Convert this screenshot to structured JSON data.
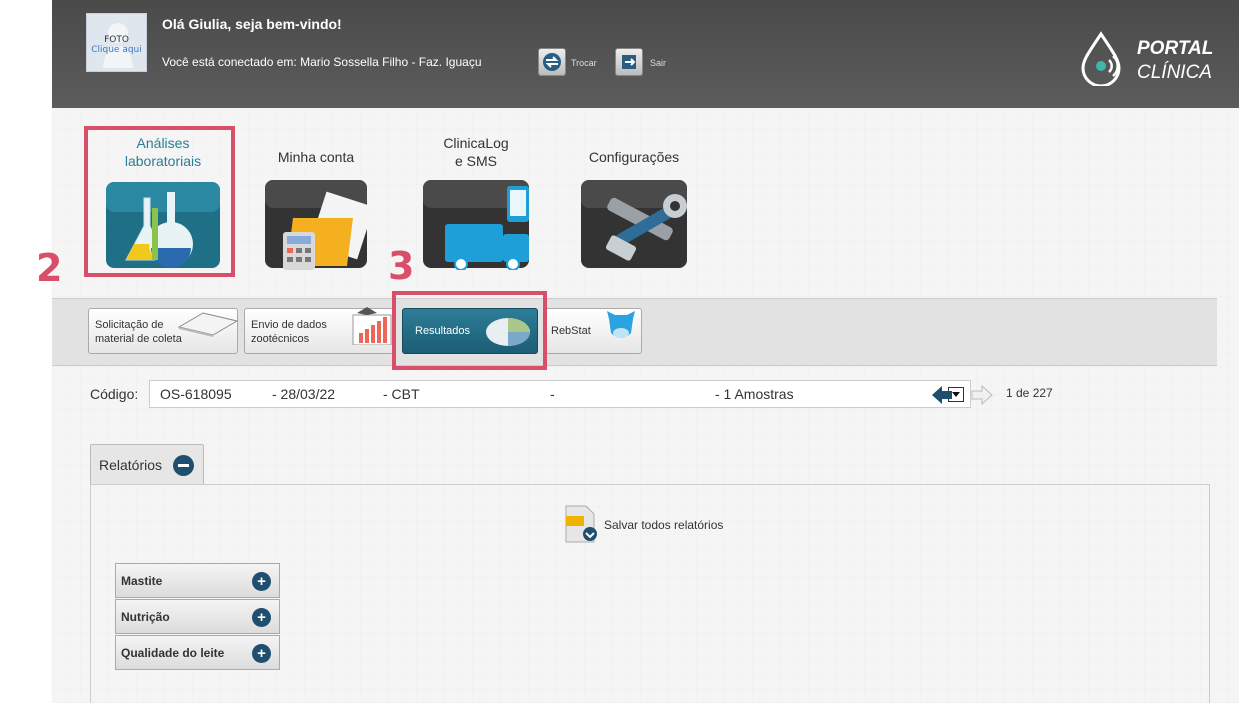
{
  "header": {
    "photo_line1": "FOTO",
    "photo_line2": "Clique aqui",
    "greeting": "Olá Giulia, seja bem-vindo!",
    "connected": "Você está conectado em: Mario Sossella Filho - Faz. Iguaçu",
    "trocar_label": "Trocar",
    "sair_label": "Sair",
    "logo_line1": "PORTAL",
    "logo_line2": "CLÍNICA"
  },
  "modules": {
    "analises_line1": "Análises",
    "analises_line2": "laboratoriais",
    "conta": "Minha conta",
    "clinicalog_line1": "ClinicaLog",
    "clinicalog_line2": "e SMS",
    "config": "Configurações"
  },
  "steps": {
    "two": "2",
    "three": "3"
  },
  "submenu": {
    "solicitacao_line1": "Solicitação de",
    "solicitacao_line2": "material de coleta",
    "envio_line1": "Envio de dados",
    "envio_line2": "zootécnicos",
    "resultados": "Resultados",
    "rebstat": "RebStat"
  },
  "code": {
    "label": "Código:",
    "os": "OS-618095",
    "date": "- 28/03/22",
    "type": "- CBT",
    "dash": "-",
    "amostras": "- 1 Amostras",
    "pager": "1 de 227"
  },
  "reports": {
    "tab_label": "Relatórios",
    "save_all": "Salvar todos relatórios",
    "categories": [
      "Mastite",
      "Nutrição",
      "Qualidade do leite"
    ]
  },
  "colors": {
    "highlight": "#d94f6a",
    "accent": "#2b7d95",
    "header": "#4f4f4f"
  },
  "icons": [
    "user-silhouette-icon",
    "swap-icon",
    "exit-icon",
    "portal-clinica-logo",
    "flask-icon",
    "folder-calculator-icon",
    "truck-phone-icon",
    "tools-icon",
    "pie-chart-icon",
    "cow-icon",
    "zip-download-icon",
    "dropdown-arrow-icon",
    "arrow-left-icon",
    "arrow-right-icon",
    "minus-circle-icon",
    "plus-circle-icon"
  ]
}
